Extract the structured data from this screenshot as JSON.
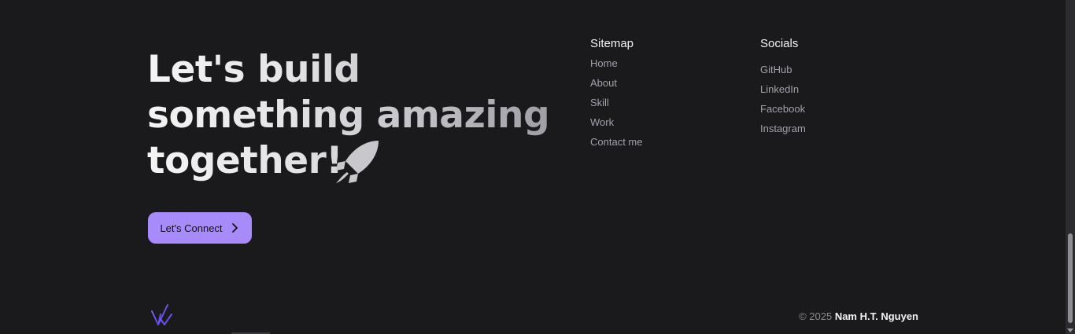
{
  "hero": {
    "line1": "Let's build",
    "line2": "something amazing",
    "line3": "together!",
    "icon": "rocket-icon"
  },
  "cta": {
    "label": "Let's Connect",
    "icon": "chevron-right-icon",
    "color": "#a78bfa"
  },
  "sitemap": {
    "title": "Sitemap",
    "items": [
      "Home",
      "About",
      "Skill",
      "Work",
      "Contact me"
    ]
  },
  "socials": {
    "title": "Socials",
    "items": [
      "GitHub",
      "LinkedIn",
      "Facebook",
      "Instagram"
    ]
  },
  "footer": {
    "copyright_prefix": "© 2025",
    "owner_name": "Nam H.T. Nguyen",
    "logo_icon": "logo-icon"
  },
  "colors": {
    "background": "#1a1a1d",
    "accent": "#a78bfa",
    "text_primary": "#f4f4f5",
    "text_muted": "#a1a1aa"
  }
}
